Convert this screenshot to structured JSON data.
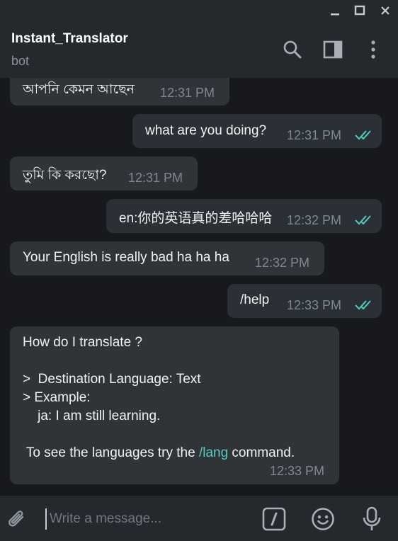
{
  "window": {
    "icons": [
      "minimize-icon",
      "maximize-icon",
      "close-icon"
    ]
  },
  "header": {
    "title": "Instant_Translator",
    "subtitle": "bot",
    "icons": [
      "search-icon",
      "sidebar-toggle-icon",
      "more-vert-icon"
    ]
  },
  "messages": [
    {
      "side": "in",
      "text": "আপনি কেমন আছেন",
      "time": "12:31 PM"
    },
    {
      "side": "out",
      "text": "what are you doing?",
      "time": "12:31 PM",
      "read": true
    },
    {
      "side": "in",
      "text": "তুমি কি করছো?",
      "time": "12:31 PM"
    },
    {
      "side": "out",
      "text": "en:你的英语真的差哈哈哈",
      "time": "12:32 PM",
      "read": true
    },
    {
      "side": "in",
      "text": "Your English is really bad ha ha ha",
      "time": "12:32 PM"
    },
    {
      "side": "out",
      "text": "/help",
      "time": "12:33 PM",
      "read": true
    },
    {
      "side": "in",
      "lines": [
        "How do I translate ?",
        "",
        ">  Destination Language: Text",
        "> Example:",
        "    ja: I am still learning.",
        "",
        " To see the languages try the "
      ],
      "link": "/lang",
      "after_link": " command.",
      "time": "12:33 PM"
    }
  ],
  "composer": {
    "placeholder": "Write a message...",
    "icons": [
      "attach-icon",
      "bot-command-icon",
      "emoji-icon",
      "microphone-icon"
    ]
  },
  "colors": {
    "accent": "#56c8c0",
    "background": "#17191c",
    "bubble": "#2e3238",
    "header": "#25292e"
  }
}
